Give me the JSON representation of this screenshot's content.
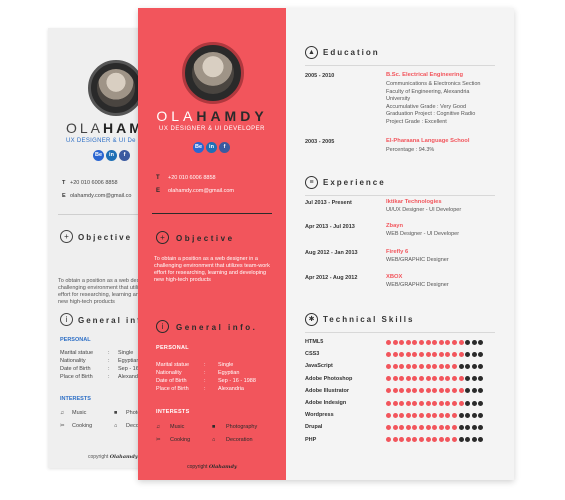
{
  "name": {
    "first": "OLA",
    "last": "HAMDY"
  },
  "role": "UX DESIGNER & UI DEVELOPER",
  "social": [
    "Be",
    "in",
    "f"
  ],
  "contact": {
    "phone_label": "T",
    "phone": "+20 010 6006 8858",
    "email_label": "E",
    "email": "olahamdy.com@gmail.com"
  },
  "back": {
    "role": "UX DESIGNER & UI De",
    "phone": "+20 010 6006 8858",
    "email": "olahamdy.com@gmail.co",
    "objective_title": "Objective",
    "general_title": "General inf",
    "personal": [
      "Marital statue",
      "Nationality",
      "Date of Birth",
      "Place of Birth"
    ],
    "personal_values": [
      "Single",
      "Egyptian",
      "Sep - 16",
      "Alexandr"
    ],
    "interests": [
      "Music",
      "Cooking"
    ],
    "interests2": [
      "Photo",
      "Decor"
    ]
  },
  "objective": {
    "title": "Objective",
    "text": "To obtain a position as a web designer in a challenging environment that utilizes team-work effort for researching, learning and developing new high-tech products"
  },
  "general": {
    "title": "General info.",
    "personal_title": "PERSONAL",
    "personal": [
      {
        "k": "Marital statue",
        "v": "Single"
      },
      {
        "k": "Nationality",
        "v": "Egyptian"
      },
      {
        "k": "Date of Birth",
        "v": "Sep - 16 - 1988"
      },
      {
        "k": "Place of Birth",
        "v": "Alexandria"
      }
    ],
    "interests_title": "INTERESTS",
    "interests": [
      "Music",
      "Photography",
      "Cooking",
      "Decoration"
    ]
  },
  "copyright": {
    "label": "copyright",
    "sig": "Olahamdy"
  },
  "education": {
    "title": "Education",
    "items": [
      {
        "date": "2005 - 2010",
        "title": "B.Sc. Electrical Engineering",
        "lines": [
          "Communications & Electronics Section",
          "Faculty of Engineering, Alexandria",
          "University",
          "Accumulative Grade : Very Good",
          "Graduation Project : Cognitive Radio",
          "Project Grade : Excellent"
        ]
      },
      {
        "date": "2003 - 2005",
        "title": "El-Pharaana Language School",
        "lines": [
          "Percentage : 94.3%"
        ]
      }
    ]
  },
  "experience": {
    "title": "Experience",
    "items": [
      {
        "date": "Jul 2013 - Present",
        "company": "Iktikar Technologies",
        "role": "UI/UX Designer - UI Developer"
      },
      {
        "date": "Apr 2013 - Jul 2013",
        "company": "Zbayn",
        "role": "WEB Designer - UI Developer"
      },
      {
        "date": "Aug 2012 - Jan 2013",
        "company": "Firefly 6",
        "role": "WEB/GRAPHIC Designer"
      },
      {
        "date": "Apr 2012 - Aug 2012",
        "company": "XBOX",
        "role": "WEB/GRAPHIC Designer"
      }
    ]
  },
  "skills": {
    "title": "Technical Skills",
    "total": 15,
    "items": [
      {
        "name": "HTML5",
        "level": 12
      },
      {
        "name": "CSS3",
        "level": 12
      },
      {
        "name": "JavaScript",
        "level": 11
      },
      {
        "name": "Adobe Photoshop",
        "level": 12
      },
      {
        "name": "Adobe Illustrator",
        "level": 12
      },
      {
        "name": "Adobe Indesign",
        "level": 12
      },
      {
        "name": "Wordpress",
        "level": 11
      },
      {
        "name": "Drupal",
        "level": 11
      },
      {
        "name": "PHP",
        "level": 11
      }
    ]
  },
  "colors": {
    "accent": "#f2555c",
    "dark": "#2b2b2b",
    "dot_off": "#2b2b2b",
    "behance": "#2b66d1",
    "linkedin": "#1f6fb5",
    "facebook": "#3b5aa0"
  }
}
